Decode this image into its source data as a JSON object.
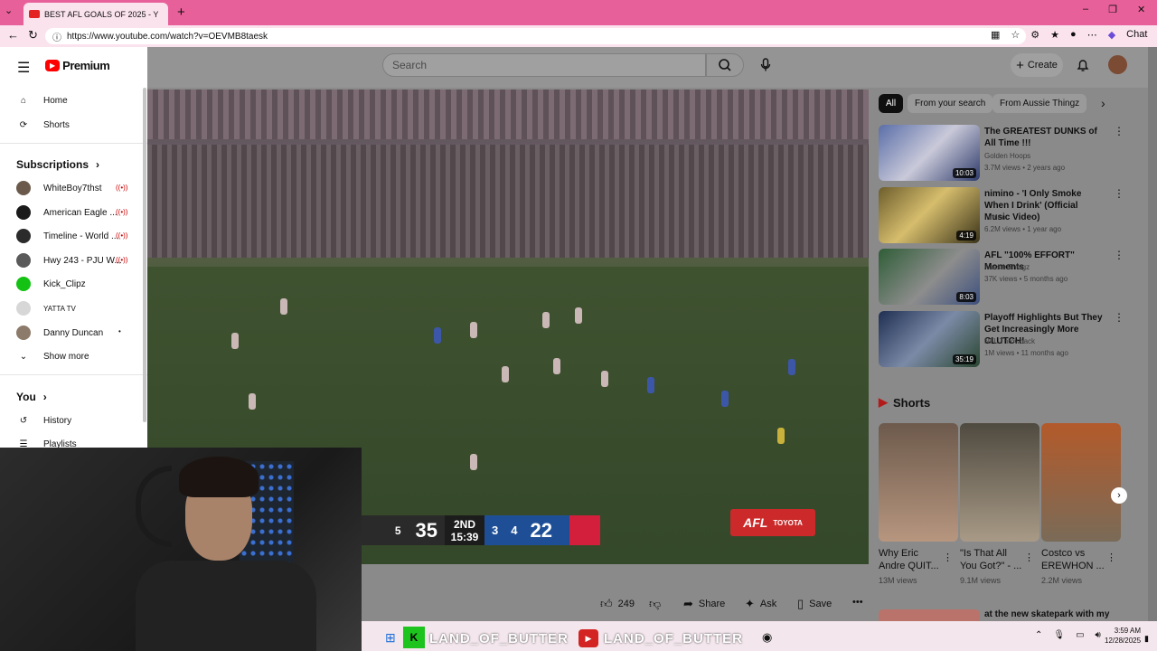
{
  "browser": {
    "tab_title": "BEST AFL GOALS OF 2025 - YouTu",
    "url": "https://www.youtube.com/watch?v=OEVMB8taesk",
    "chat_label": "Chat"
  },
  "header": {
    "logo": "Premium",
    "search_placeholder": "Search",
    "create_label": "Create"
  },
  "sidebar": {
    "nav": [
      {
        "label": "Home",
        "icon": "home-icon"
      },
      {
        "label": "Shorts",
        "icon": "shorts-icon"
      }
    ],
    "subscriptions_title": "Subscriptions",
    "subscriptions": [
      {
        "label": "WhiteBoy7thst",
        "live": true
      },
      {
        "label": "American Eagle ...",
        "live": true
      },
      {
        "label": "Timeline - World ...",
        "live": true
      },
      {
        "label": "Hwy 243 - PJU W...",
        "live": true
      },
      {
        "label": "Kick_Clipz",
        "live": false
      },
      {
        "label": "YATTA TV",
        "live": false
      },
      {
        "label": "Danny Duncan",
        "live": false,
        "dot": true
      }
    ],
    "show_more": "Show more",
    "you_title": "You",
    "you_items": [
      {
        "label": "History",
        "icon": "history-icon"
      },
      {
        "label": "Playlists",
        "icon": "playlists-icon"
      }
    ]
  },
  "video": {
    "score_left": "35",
    "score_left_partial": "5",
    "quarter": "2ND",
    "clock": "15:39",
    "goals": "3",
    "behinds": "4",
    "score_right": "22",
    "league_logo": "AFL",
    "sponsor": "TOYOTA"
  },
  "actions": {
    "likes": "249",
    "share": "Share",
    "ask": "Ask",
    "save": "Save"
  },
  "chips": [
    "All",
    "From your search",
    "From Aussie Thingz"
  ],
  "recommendations": [
    {
      "title": "The GREATEST DUNKS of All Time !!!",
      "channel": "Golden Hoops",
      "meta": "3.7M views • 2 years ago",
      "duration": "10:03",
      "verified": true
    },
    {
      "title": "nimino - 'I Only Smoke When I Drink' (Official Music Video)",
      "channel": "nimino",
      "meta": "6.2M views • 1 year ago",
      "duration": "4:19",
      "verified": true
    },
    {
      "title": "AFL \"100% EFFORT\" Moments",
      "channel": "Aussie Thingz",
      "meta": "37K views • 5 months ago",
      "duration": "8:03",
      "verified": false
    },
    {
      "title": "Playoff Highlights But They Get Increasingly More CLUTCH!",
      "channel": "NFL Throwback",
      "meta": "1M views • 11 months ago",
      "duration": "35:19",
      "verified": true
    }
  ],
  "shorts": {
    "title": "Shorts",
    "items": [
      {
        "caption": "Why Eric Andre QUIT...",
        "views": "13M views"
      },
      {
        "caption": "\"Is That All You Got?\" - ...",
        "views": "9.1M views"
      },
      {
        "caption": "Costco vs EREWHON ...",
        "views": "2.2M views"
      }
    ]
  },
  "next_rec_title": "at the new skatepark with my",
  "taskbar": {
    "time": "3:59 AM",
    "date": "12/28/2025",
    "overlay_text": "LAND_OF_BUTTER"
  }
}
